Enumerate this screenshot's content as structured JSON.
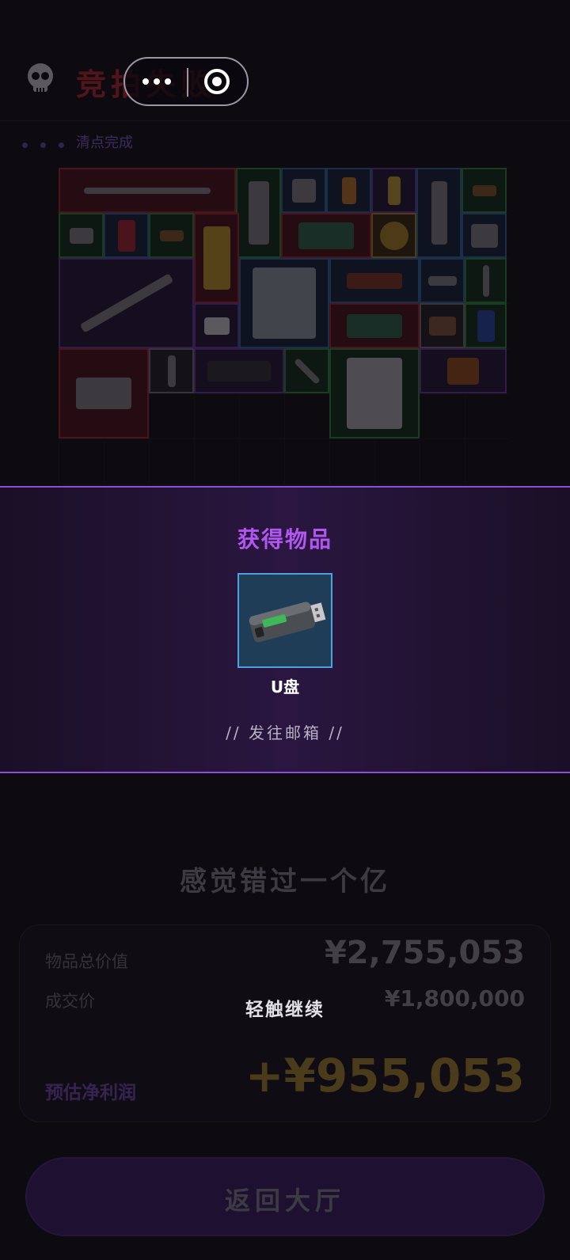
{
  "header": {
    "title": "竞拍失败",
    "status": "清点完成"
  },
  "reward": {
    "title": "获得物品",
    "item_name": "U盘",
    "mail_link": "// 发往邮箱 //"
  },
  "summary": {
    "slogan": "感觉错过一个亿",
    "total_value_label": "物品总价值",
    "total_value": "¥2,755,053",
    "deal_price_label": "成交价",
    "deal_price": "¥1,800,000",
    "profit_label": "预估净利润",
    "profit": "+¥955,053"
  },
  "tap_hint": "轻触继续",
  "back_button": "返回大厅",
  "colors": {
    "accent": "#b157f0",
    "fail_red": "#c4252e",
    "profit_gold": "#b08c2c"
  }
}
